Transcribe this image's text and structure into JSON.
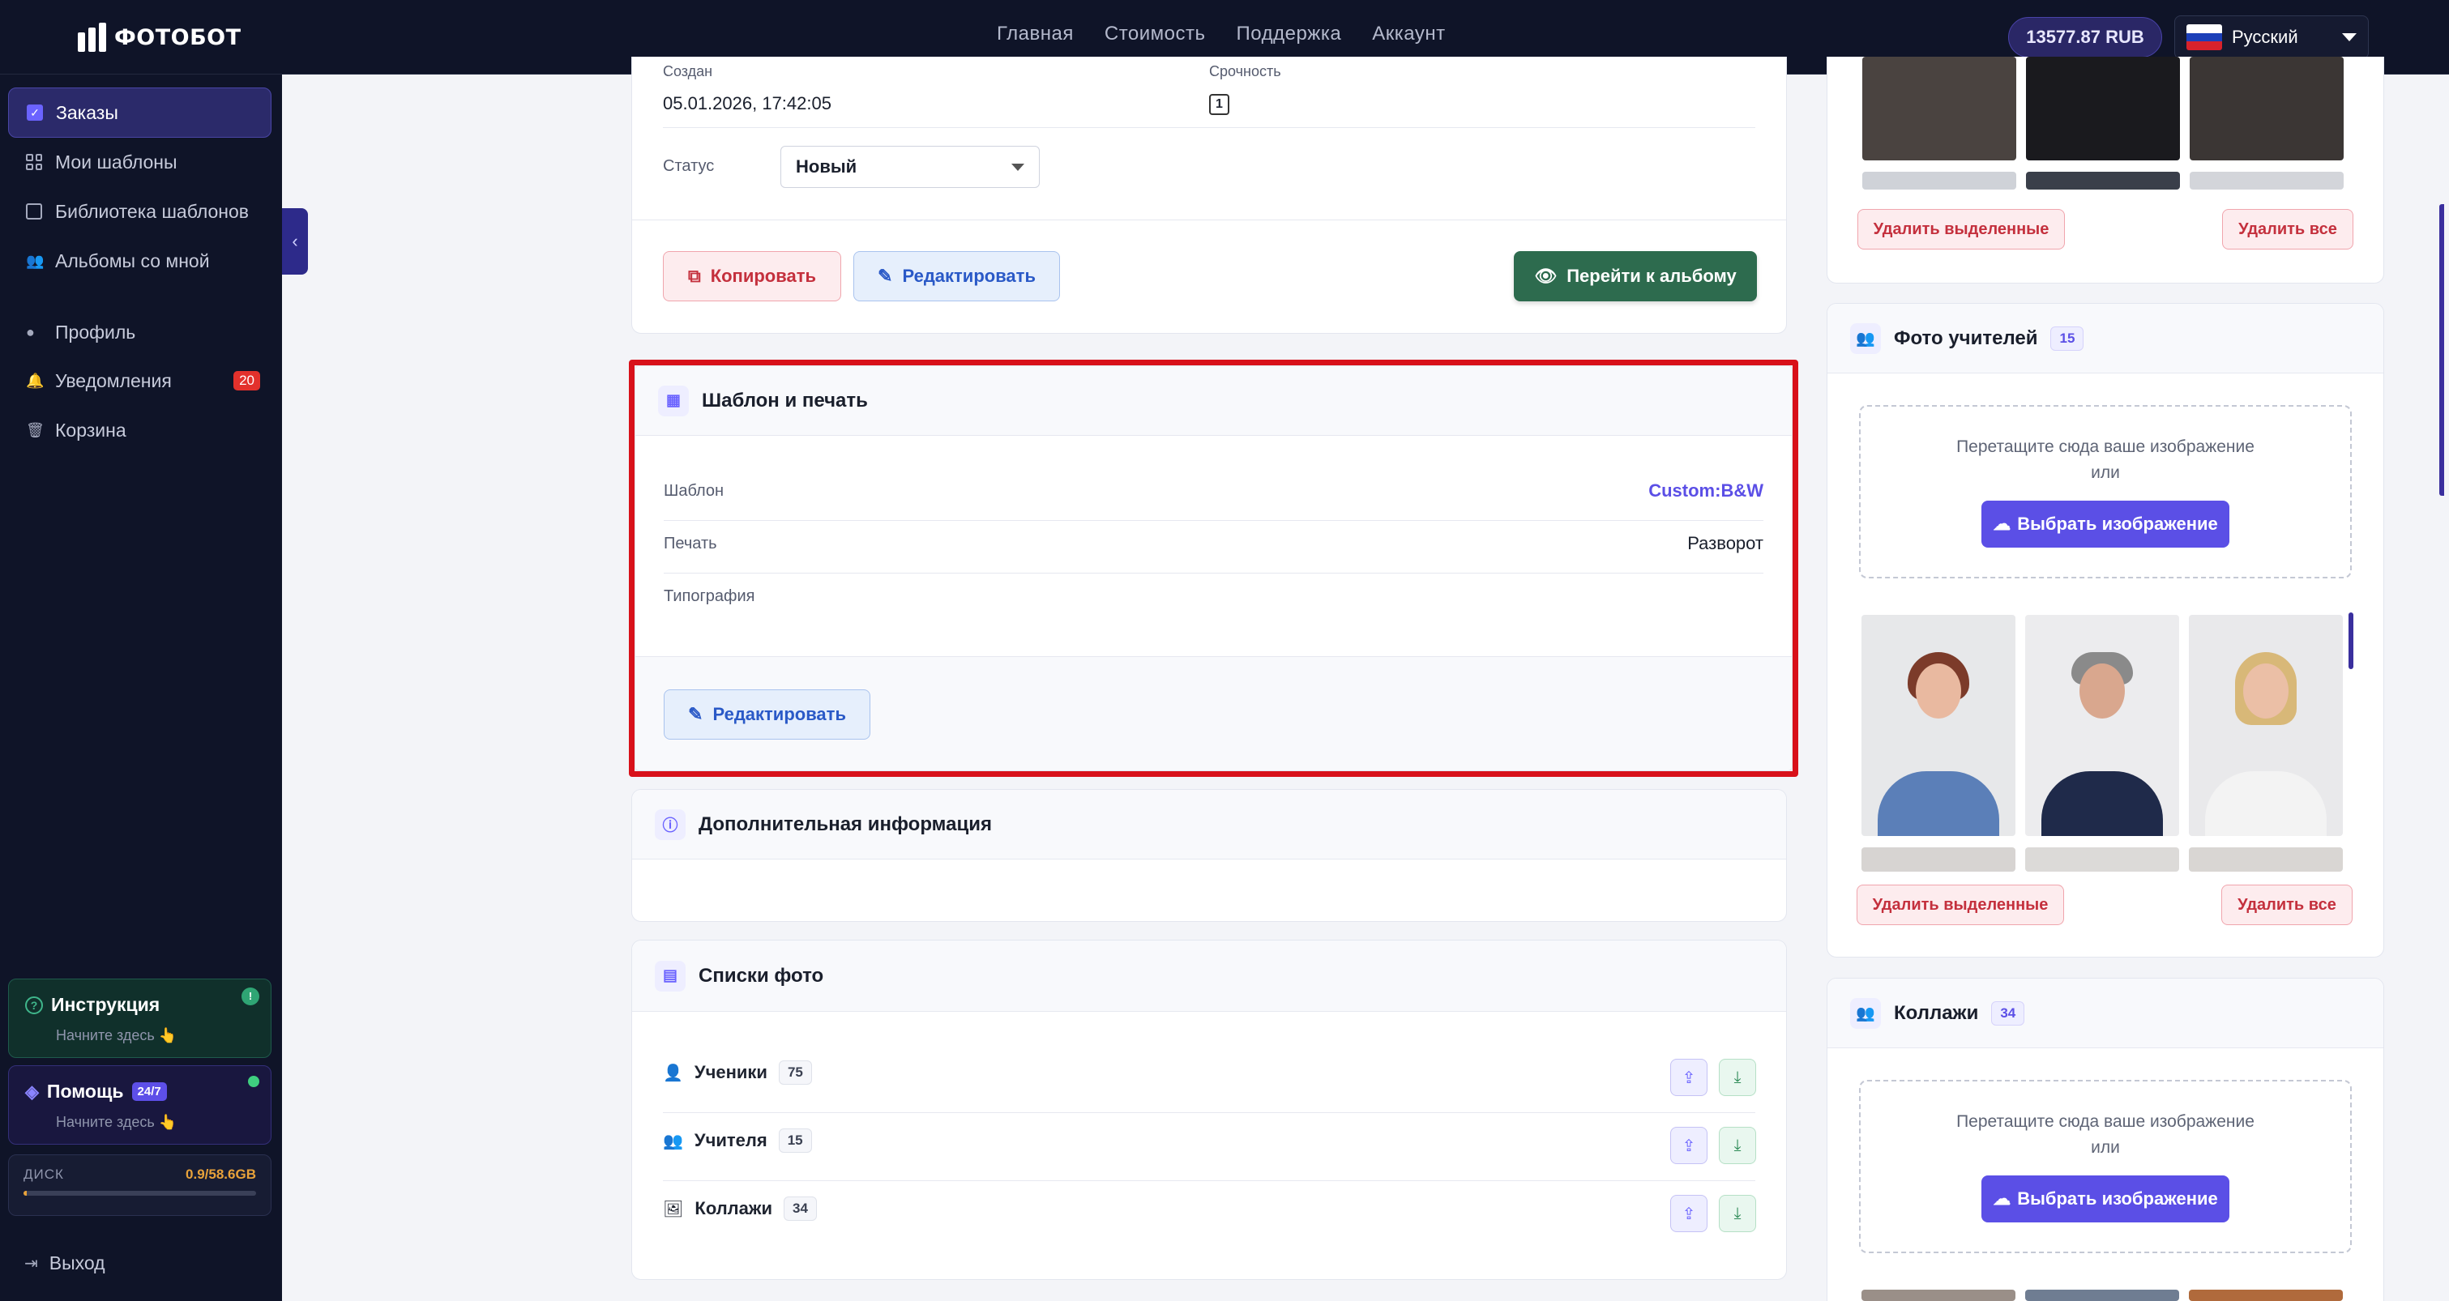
{
  "topbar": {
    "logo": "ФОТОБОТ",
    "nav": [
      "Главная",
      "Стоимость",
      "Поддержка",
      "Аккаунт"
    ],
    "balance": "13577.87 RUB",
    "language": "Русский"
  },
  "sidebar": {
    "items": [
      {
        "label": "Заказы",
        "icon": "checkbox-icon"
      },
      {
        "label": "Мои шаблоны",
        "icon": "grid-icon"
      },
      {
        "label": "Библиотека шаблонов",
        "icon": "book-icon"
      },
      {
        "label": "Альбомы со мной",
        "icon": "users-icon"
      },
      {
        "label": "Профиль",
        "icon": "user-icon"
      },
      {
        "label": "Уведомления",
        "icon": "bell-icon",
        "badge": "20"
      },
      {
        "label": "Корзина",
        "icon": "trash-icon"
      }
    ],
    "instruction": {
      "title": "Инструкция",
      "subtitle": "Начните здесь 👆",
      "badge": "!"
    },
    "help": {
      "title": "Помощь",
      "badge": "24/7",
      "subtitle": "Начните здесь 👆"
    },
    "disk": {
      "label": "ДИСК",
      "value": "0.9/58.6GB",
      "fill_fraction": 0.015
    },
    "logout": "Выход"
  },
  "order": {
    "created_label": "Создан",
    "created_value": "05.01.2026, 17:42:05",
    "urgency_label": "Срочность",
    "urgency_value": "1",
    "status_label": "Статус",
    "status_value": "Новый",
    "copy_button": "Копировать",
    "edit_button": "Редактировать",
    "goto_button": "Перейти к альбому"
  },
  "template_print": {
    "title": "Шаблон и печать",
    "rows": [
      {
        "label": "Шаблон",
        "value": "Custom:B&W"
      },
      {
        "label": "Печать",
        "value": "Разворот"
      },
      {
        "label": "Типография",
        "value": ""
      }
    ],
    "edit_button": "Редактировать"
  },
  "extra_info": {
    "title": "Дополнительная информация"
  },
  "photo_lists": {
    "title": "Списки фото",
    "rows": [
      {
        "label": "Ученики",
        "count": "75"
      },
      {
        "label": "Учителя",
        "count": "15"
      },
      {
        "label": "Коллажи",
        "count": "34"
      }
    ]
  },
  "right": {
    "delete_selected": "Удалить выделенные",
    "delete_all": "Удалить все",
    "teachers": {
      "title": "Фото учителей",
      "count": "15"
    },
    "collages": {
      "title": "Коллажи",
      "count": "34"
    },
    "drop_text_1": "Перетащите сюда ваше изображение",
    "drop_text_2": "или",
    "pick_button": "Выбрать изображение"
  },
  "colors": {
    "accent": "#5b4fe6",
    "highlight": "#d8111a",
    "go_button": "#2d6b4e"
  }
}
